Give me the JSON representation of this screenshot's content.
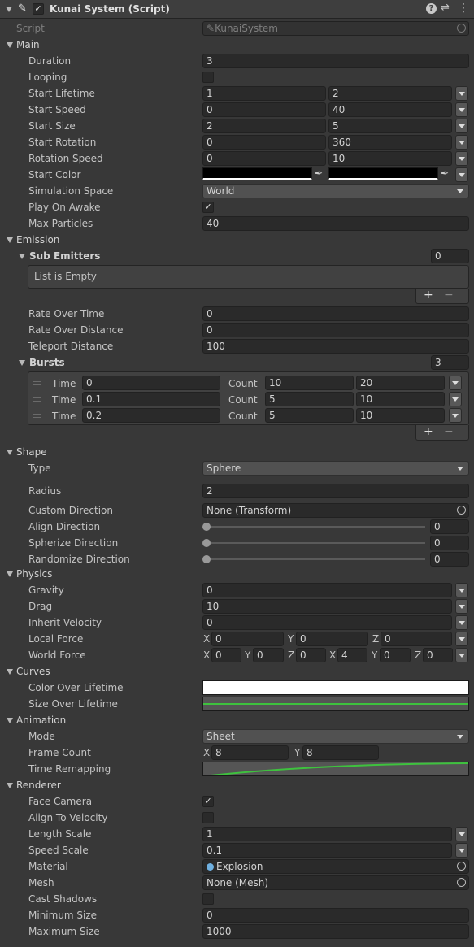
{
  "header": {
    "title": "Kunai System (Script)"
  },
  "script": {
    "label": "Script",
    "value": "KunaiSystem"
  },
  "main": {
    "title": "Main",
    "duration": {
      "label": "Duration",
      "value": "3"
    },
    "looping": {
      "label": "Looping"
    },
    "start_lifetime": {
      "label": "Start Lifetime",
      "min": "1",
      "max": "2"
    },
    "start_speed": {
      "label": "Start Speed",
      "min": "0",
      "max": "40"
    },
    "start_size": {
      "label": "Start Size",
      "min": "2",
      "max": "5"
    },
    "start_rotation": {
      "label": "Start Rotation",
      "min": "0",
      "max": "360"
    },
    "rotation_speed": {
      "label": "Rotation Speed",
      "min": "0",
      "max": "10"
    },
    "start_color": {
      "label": "Start Color",
      "color_a": "#000000",
      "color_b": "#000000"
    },
    "simulation_space": {
      "label": "Simulation Space",
      "value": "World"
    },
    "play_on_awake": {
      "label": "Play On Awake"
    },
    "max_particles": {
      "label": "Max Particles",
      "value": "40"
    }
  },
  "emission": {
    "title": "Emission",
    "sub_emitters": {
      "label": "Sub Emitters",
      "count": "0",
      "empty_text": "List is Empty"
    },
    "rate_over_time": {
      "label": "Rate Over Time",
      "value": "0"
    },
    "rate_over_distance": {
      "label": "Rate Over Distance",
      "value": "0"
    },
    "teleport_distance": {
      "label": "Teleport Distance",
      "value": "100"
    },
    "bursts": {
      "label": "Bursts",
      "count": "3",
      "time_label": "Time",
      "count_label": "Count",
      "rows": [
        {
          "time": "0",
          "min": "10",
          "max": "20"
        },
        {
          "time": "0.1",
          "min": "5",
          "max": "10"
        },
        {
          "time": "0.2",
          "min": "5",
          "max": "10"
        }
      ]
    }
  },
  "shape": {
    "title": "Shape",
    "type": {
      "label": "Type",
      "value": "Sphere"
    },
    "radius": {
      "label": "Radius",
      "value": "2"
    },
    "custom_direction": {
      "label": "Custom Direction",
      "value": "None (Transform)"
    },
    "align_direction": {
      "label": "Align Direction",
      "value": "0"
    },
    "spherize_direction": {
      "label": "Spherize Direction",
      "value": "0"
    },
    "randomize_direction": {
      "label": "Randomize Direction",
      "value": "0"
    }
  },
  "physics": {
    "title": "Physics",
    "gravity": {
      "label": "Gravity",
      "value": "0"
    },
    "drag": {
      "label": "Drag",
      "value": "10"
    },
    "inherit_velocity": {
      "label": "Inherit Velocity",
      "value": "0"
    },
    "local_force": {
      "label": "Local Force",
      "x": "0",
      "y": "0",
      "z": "0"
    },
    "world_force": {
      "label": "World Force",
      "min_x": "0",
      "min_y": "0",
      "min_z": "0",
      "max_x": "4",
      "max_y": "0",
      "max_z": "0"
    }
  },
  "curves": {
    "title": "Curves",
    "color_over_lifetime": {
      "label": "Color Over Lifetime"
    },
    "size_over_lifetime": {
      "label": "Size Over Lifetime"
    }
  },
  "animation": {
    "title": "Animation",
    "mode": {
      "label": "Mode",
      "value": "Sheet"
    },
    "frame_count": {
      "label": "Frame Count",
      "x": "8",
      "y": "8"
    },
    "time_remapping": {
      "label": "Time Remapping"
    }
  },
  "renderer": {
    "title": "Renderer",
    "face_camera": {
      "label": "Face Camera"
    },
    "align_to_velocity": {
      "label": "Align To Velocity"
    },
    "length_scale": {
      "label": "Length Scale",
      "value": "1"
    },
    "speed_scale": {
      "label": "Speed Scale",
      "value": "0.1"
    },
    "material": {
      "label": "Material",
      "value": "Explosion"
    },
    "mesh": {
      "label": "Mesh",
      "value": "None (Mesh)"
    },
    "cast_shadows": {
      "label": "Cast Shadows"
    },
    "minimum_size": {
      "label": "Minimum Size",
      "value": "0"
    },
    "maximum_size": {
      "label": "Maximum Size",
      "value": "1000"
    }
  },
  "axis": {
    "x": "X",
    "y": "Y",
    "z": "Z"
  }
}
